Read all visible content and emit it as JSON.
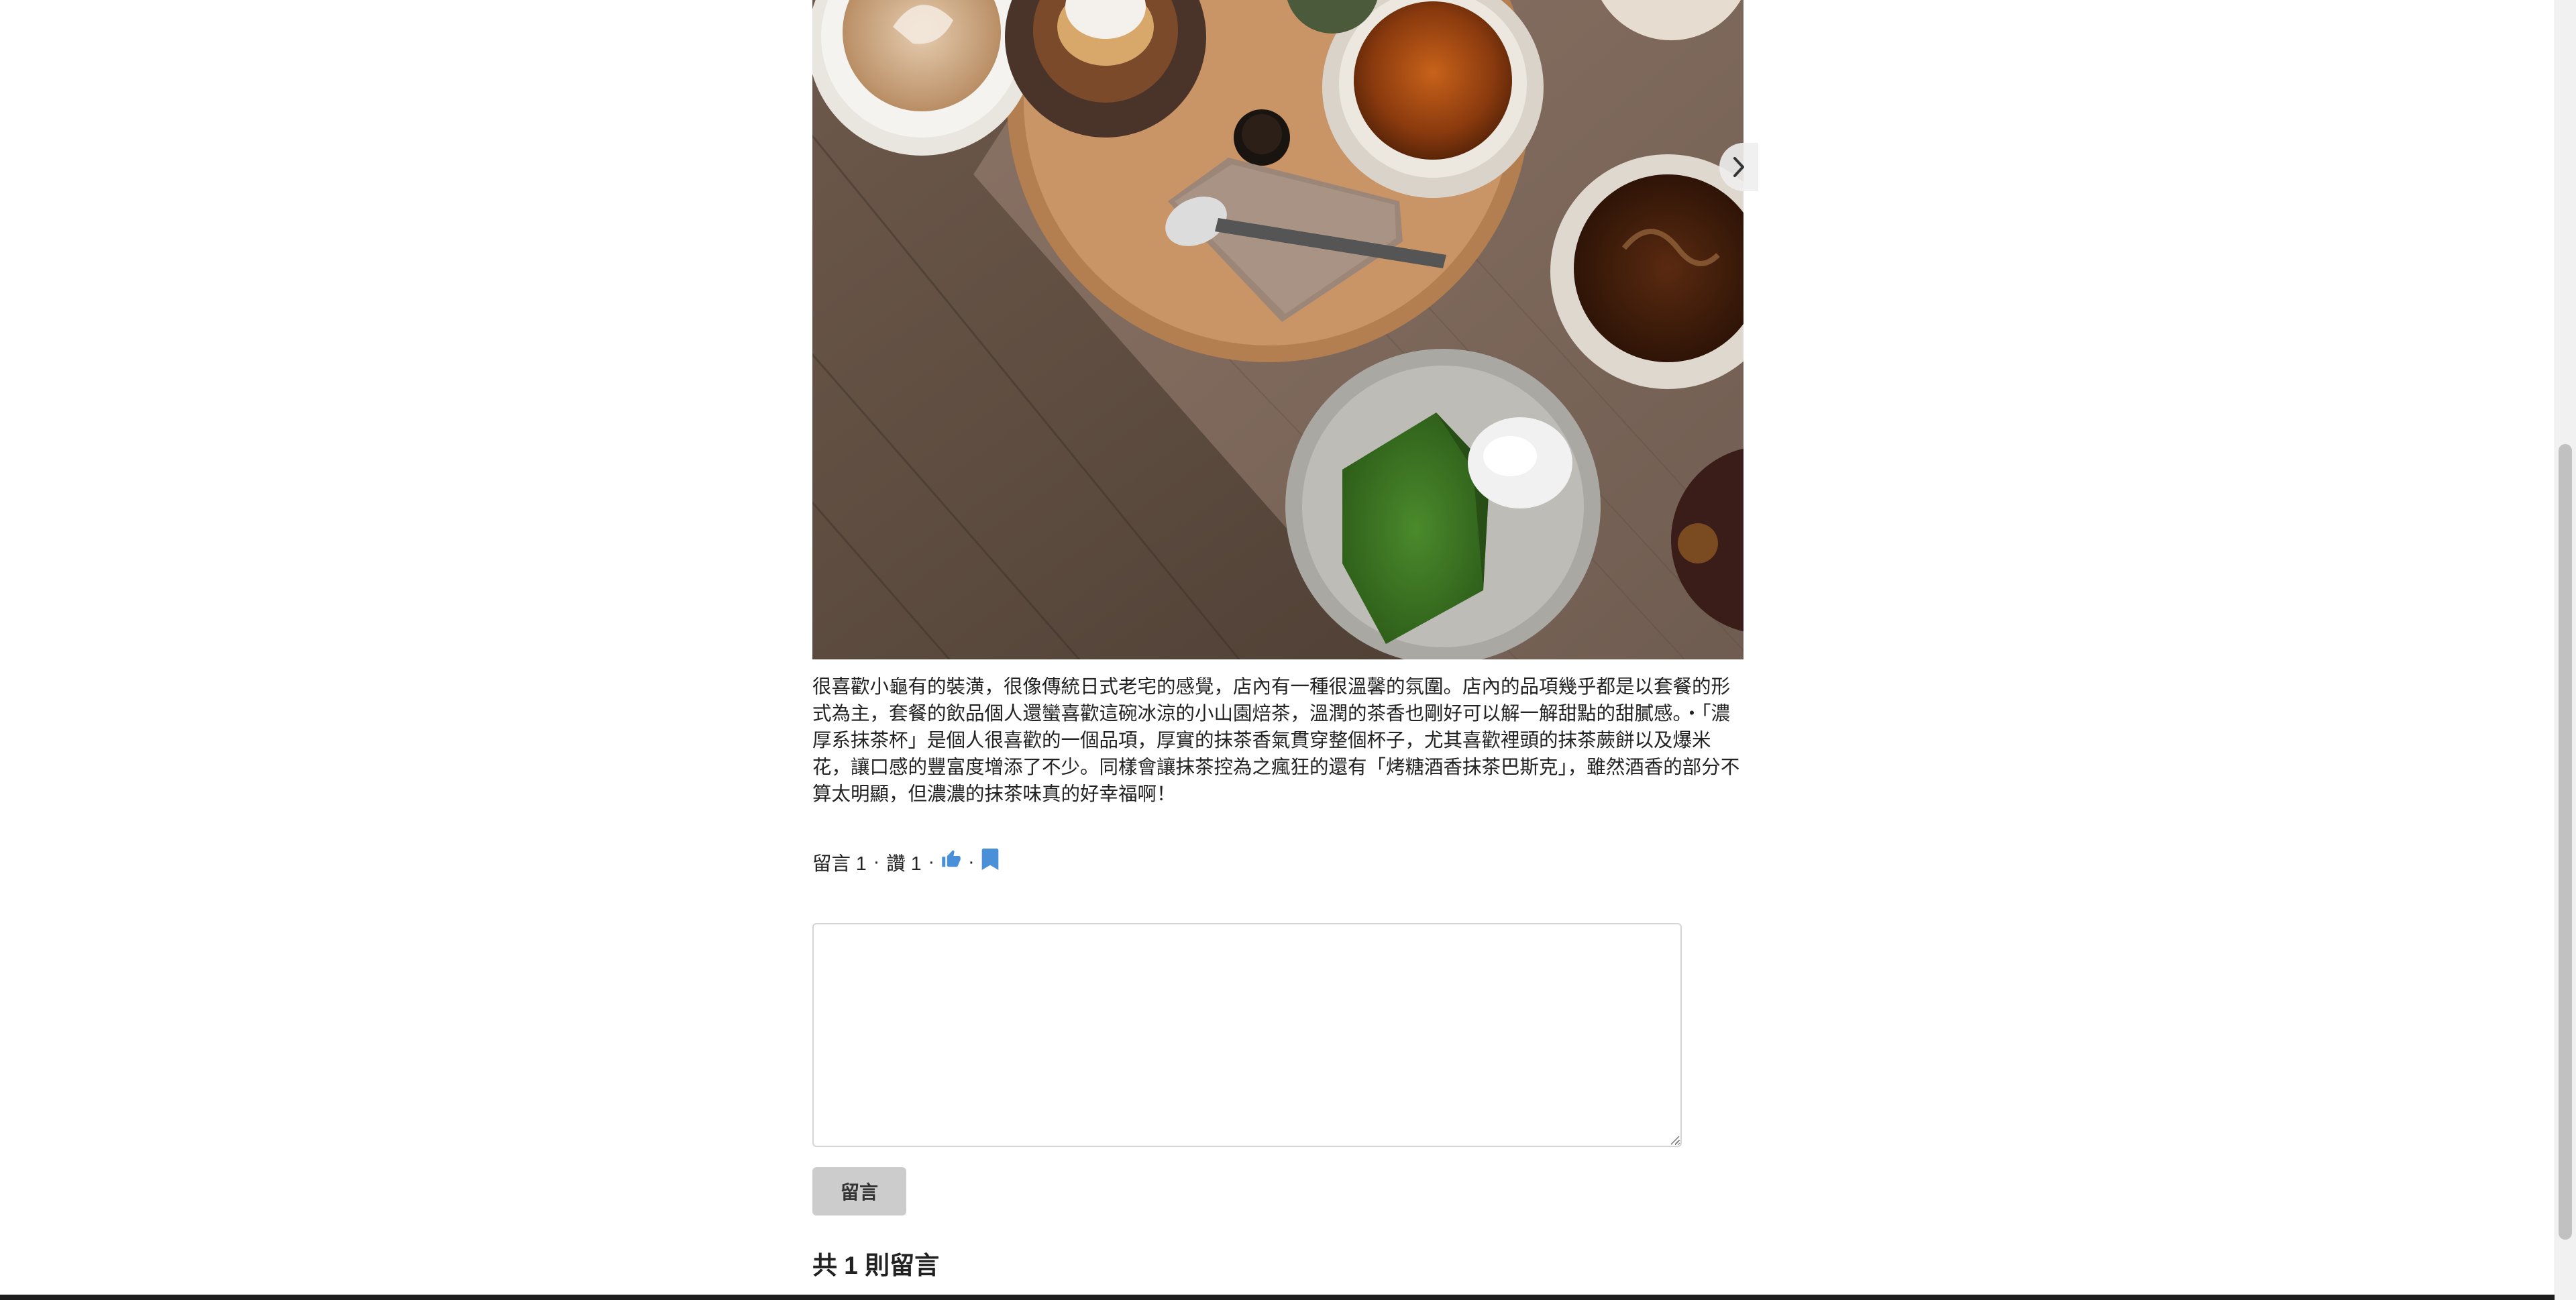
{
  "post": {
    "body": "很喜歡小龜有的裝潢，很像傳統日式老宅的感覺，店內有一種很溫馨的氛圍。店內的品項幾乎都是以套餐的形式為主，套餐的飲品個人還蠻喜歡這碗冰涼的小山園焙茶，溫潤的茶香也剛好可以解一解甜點的甜膩感。・「濃厚系抹茶杯」是個人很喜歡的一個品項，厚實的抹茶香氣貫穿整個杯子，尤其喜歡裡頭的抹茶蕨餅以及爆米花，讓口感的豐富度增添了不少。同樣會讓抹茶控為之瘋狂的還有「烤糖酒香抹茶巴斯克」，雖然酒香的部分不算太明顯，但濃濃的抹茶味真的好幸福啊！"
  },
  "meta": {
    "comments_label": "留言 1",
    "separator": "·",
    "likes_label": "讚 1",
    "like_icon": "thumbs-up-icon",
    "bookmark_icon": "bookmark-icon",
    "accent_color": "#4a90d9"
  },
  "comment_form": {
    "textarea_value": "",
    "submit_label": "留言"
  },
  "comments": {
    "count_heading": "共 1 則留言"
  },
  "photo": {
    "icon": "food-photo",
    "next_icon": "chevron-right-icon"
  }
}
